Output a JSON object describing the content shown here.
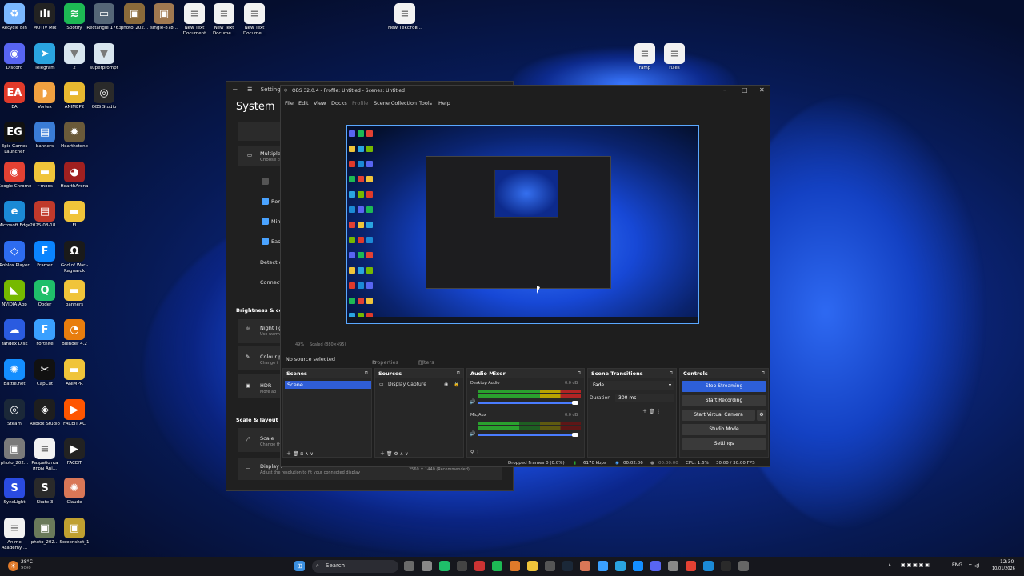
{
  "desktop": {
    "icons": [
      {
        "label": "Recycle Bin",
        "color": "#7ab7ff",
        "glyph": "♻"
      },
      {
        "label": "MOTIV Mix",
        "color": "#222222",
        "glyph": "ılı"
      },
      {
        "label": "Spotify",
        "color": "#1db954",
        "glyph": "≋"
      },
      {
        "label": "Rectangle 1763",
        "color": "#556677",
        "glyph": "▭"
      },
      {
        "label": "photo_202...",
        "color": "#8a6a3a",
        "glyph": "▣"
      },
      {
        "label": "single-878...",
        "color": "#a07850",
        "glyph": "▣"
      },
      {
        "label": "New Text Document",
        "color": "#f2f2f2",
        "glyph": "≡"
      },
      {
        "label": "New Text Docume...",
        "color": "#f2f2f2",
        "glyph": "≡"
      },
      {
        "label": "New Text Docume...",
        "color": "#f2f2f2",
        "glyph": "≡"
      },
      {
        "label": "New Текстов...",
        "color": "#f2f2f2",
        "glyph": "≡"
      },
      {
        "label": "Discord",
        "color": "#5865f2",
        "glyph": "◉"
      },
      {
        "label": "Telegram",
        "color": "#2aa4e0",
        "glyph": "➤"
      },
      {
        "label": "2",
        "color": "#d9e6ef",
        "glyph": "▼"
      },
      {
        "label": "superprompt",
        "color": "#d9e6ef",
        "glyph": "▼"
      },
      {
        "label": "EA",
        "color": "#e03a2a",
        "glyph": "EA"
      },
      {
        "label": "Vortex",
        "color": "#f0a040",
        "glyph": "◗"
      },
      {
        "label": "ANIMEP2",
        "color": "#e8b830",
        "glyph": "▬"
      },
      {
        "label": "OBS Studio",
        "color": "#2a2a2a",
        "glyph": "◎"
      },
      {
        "label": "Epic Games Launcher",
        "color": "#111111",
        "glyph": "EG"
      },
      {
        "label": "banners",
        "color": "#3a7cd6",
        "glyph": "▤"
      },
      {
        "label": "Hearthstone",
        "color": "#6a5a3a",
        "glyph": "✹"
      },
      {
        "label": "Google Chrome",
        "color": "#e34133",
        "glyph": "◉"
      },
      {
        "label": "~mods",
        "color": "#f0c43a",
        "glyph": "▬"
      },
      {
        "label": "HearthArena",
        "color": "#a02020",
        "glyph": "◕"
      },
      {
        "label": "Microsoft Edge",
        "color": "#1b8ad6",
        "glyph": "e"
      },
      {
        "label": "2025-08-18...",
        "color": "#c0392b",
        "glyph": "▤"
      },
      {
        "label": "EI",
        "color": "#f0c43a",
        "glyph": "▬"
      },
      {
        "label": "Roblox Player",
        "color": "#2d6cf0",
        "glyph": "◇"
      },
      {
        "label": "Framer",
        "color": "#0a84ff",
        "glyph": "F"
      },
      {
        "label": "God of War - Ragnarok",
        "color": "#1a1a1a",
        "glyph": "Ω"
      },
      {
        "label": "NVIDIA App",
        "color": "#76b900",
        "glyph": "◣"
      },
      {
        "label": "Qoder",
        "color": "#1fbf6a",
        "glyph": "Q"
      },
      {
        "label": "banners",
        "color": "#f0c43a",
        "glyph": "▬"
      },
      {
        "label": "Yandex Disk",
        "color": "#2a5be0",
        "glyph": "☁"
      },
      {
        "label": "Fortnite",
        "color": "#3aa0ff",
        "glyph": "F"
      },
      {
        "label": "Blender 4.2",
        "color": "#e87d0d",
        "glyph": "◔"
      },
      {
        "label": "Battle.net",
        "color": "#148eff",
        "glyph": "✺"
      },
      {
        "label": "CapCut",
        "color": "#111111",
        "glyph": "✂"
      },
      {
        "label": "ANIMPR",
        "color": "#f0c43a",
        "glyph": "▬"
      },
      {
        "label": "Steam",
        "color": "#1b2838",
        "glyph": "◎"
      },
      {
        "label": "Roblox Studio",
        "color": "#1e1e1e",
        "glyph": "◈"
      },
      {
        "label": "FACEIT AC",
        "color": "#ff5500",
        "glyph": "▶"
      },
      {
        "label": "photo_202...",
        "color": "#7a7a7a",
        "glyph": "▣"
      },
      {
        "label": "Разработка игры Ani...",
        "color": "#f2f2f2",
        "glyph": "≡"
      },
      {
        "label": "FACEIT",
        "color": "#222222",
        "glyph": "▶"
      },
      {
        "label": "SyncLight",
        "color": "#2a4be0",
        "glyph": "S"
      },
      {
        "label": "Skate 3",
        "color": "#2a2a2a",
        "glyph": "S"
      },
      {
        "label": "Claude",
        "color": "#d97757",
        "glyph": "✺"
      },
      {
        "label": "Anime Academy ...",
        "color": "#f2f2f2",
        "glyph": "≡"
      },
      {
        "label": "photo_202...",
        "color": "#6a7a5a",
        "glyph": "▣"
      },
      {
        "label": "Screenshot_1",
        "color": "#c0a030",
        "glyph": "▣"
      },
      {
        "label": "ramp",
        "color": "#f2f2f2",
        "glyph": "≡"
      },
      {
        "label": "rules",
        "color": "#f2f2f2",
        "glyph": "≡"
      }
    ]
  },
  "settings": {
    "window_title": "Settings",
    "title": "System",
    "multiple": "Multiple",
    "choose": "Choose th",
    "items": [
      "Rem",
      "Min",
      "Eas"
    ],
    "detect": "Detect o",
    "connect": "Connect",
    "brightness_section": "Brightness & colo",
    "night_light": "Night lig",
    "night_sub": "Use warm",
    "colour": "Colour p",
    "colour_sub": "Change t",
    "hdr": "HDR",
    "hdr_sub": "More ab",
    "scale_section": "Scale & layout",
    "scale": "Scale",
    "scale_sub": "Change th",
    "display": "Display r",
    "display_sub": "Adjust the resolution to fit your connected display",
    "display_value": "2560 × 1440 (Recommended)"
  },
  "obs": {
    "title": "OBS 32.0.4 - Profile: Untitled - Scenes: Untitled",
    "menu": [
      "File",
      "Edit",
      "View",
      "Docks",
      "Profile",
      "Scene Collection",
      "Tools",
      "Help"
    ],
    "zoom": "49%",
    "scaled": "Scaled (880×495)",
    "no_source": "No source selected",
    "properties": "Properties",
    "filters": "Filters",
    "scenes_title": "Scenes",
    "scene_item": "Scene",
    "sources_title": "Sources",
    "source_item": "Display Capture",
    "mixer_title": "Audio Mixer",
    "desktop_audio": "Desktop Audio",
    "desktop_db": "0.0 dB",
    "mic_aux": "Mic/Aux",
    "mic_db": "0.0 dB",
    "transitions_title": "Scene Transitions",
    "transition_value": "Fade",
    "duration_label": "Duration",
    "duration_value": "300 ms",
    "controls_title": "Controls",
    "controls": {
      "stop_streaming": "Stop Streaming",
      "start_recording": "Start Recording",
      "start_virtual_camera": "Start Virtual Camera",
      "studio_mode": "Studio Mode",
      "settings": "Settings"
    },
    "status": {
      "dropped": "Dropped Frames 0 (0.0%)",
      "kbps": "6170 kbps",
      "stream_time": "00:02:06",
      "rec_time": "00:00:00",
      "cpu": "CPU: 1.6%",
      "fps": "30.00 / 30.00 FPS"
    }
  },
  "taskbar": {
    "weather": "28°C",
    "weather_sub": "Ясно",
    "search": "Search",
    "lang": "ENG",
    "time": "12:30",
    "date": "10/01/2026"
  },
  "colors": {
    "accent": "#2d5fd8",
    "selection_border": "#5aa8ff"
  }
}
